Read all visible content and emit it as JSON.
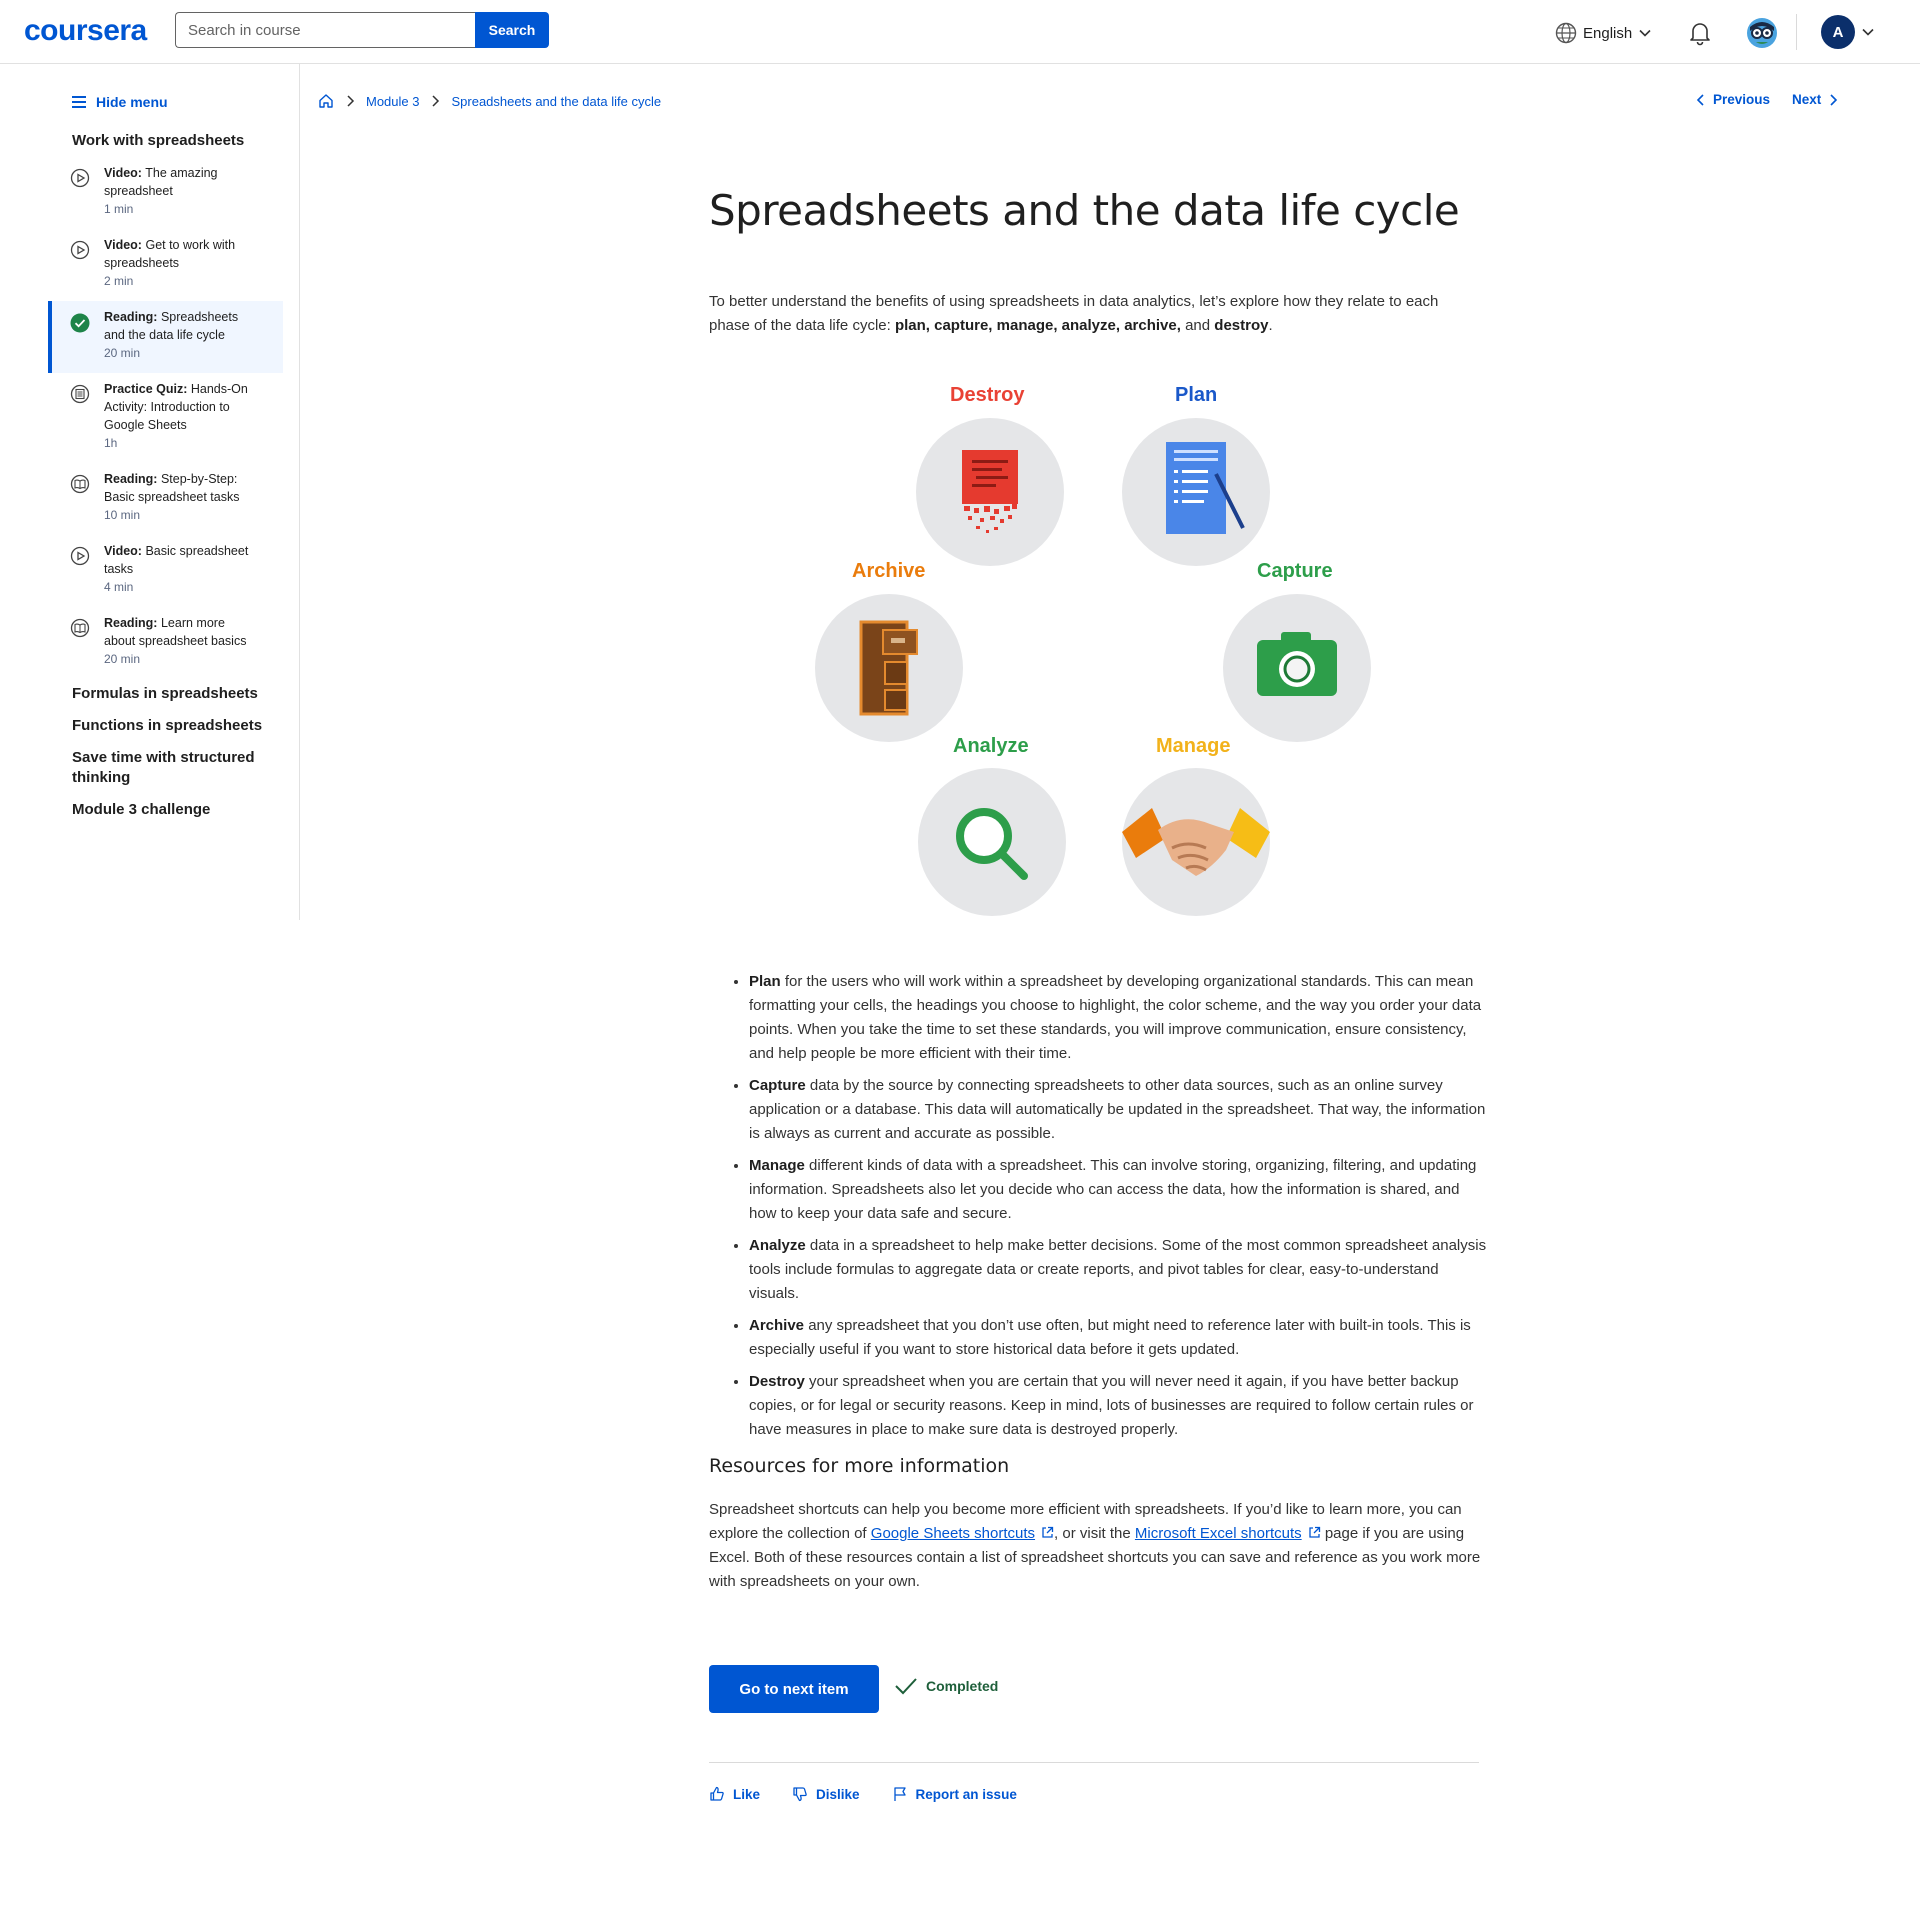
{
  "header": {
    "logo": "coursera",
    "search_placeholder": "Search in course",
    "search_button": "Search",
    "language": "English",
    "avatar_initial": "A",
    "icons": [
      "globe-icon",
      "chevron-down-icon",
      "bell-icon",
      "coach-icon"
    ]
  },
  "sidebar": {
    "hide_menu": "Hide menu",
    "current_section": "Work with spreadsheets",
    "items": [
      {
        "type": "Video:",
        "title": "The amazing spreadsheet",
        "title_l1": "The amazing",
        "title_l2": "spreadsheet",
        "duration": "1 min",
        "icon": "play-icon"
      },
      {
        "type": "Video:",
        "title": "Get to work with spreadsheets",
        "title_l1": "Get to work with",
        "title_l2": "spreadsheets",
        "duration": "2 min",
        "icon": "play-icon"
      },
      {
        "type": "Reading:",
        "title": "Spreadsheets and the data life cycle",
        "title_l1": "Spreadsheets",
        "title_l2": "and the data life cycle",
        "duration": "20 min",
        "icon": "check-circle-icon",
        "active": true
      },
      {
        "type": "Practice Quiz:",
        "title": "Hands-On Activity: Introduction to Google Sheets",
        "title_l1": "Hands-On",
        "title_l2": "Activity: Introduction to",
        "title_l3": "Google Sheets",
        "duration": "1h",
        "icon": "quiz-icon"
      },
      {
        "type": "Reading:",
        "title": "Step-by-Step: Basic spreadsheet tasks",
        "title_l1": "Step-by-Step:",
        "title_l2": "Basic spreadsheet tasks",
        "duration": "10 min",
        "icon": "book-icon"
      },
      {
        "type": "Video:",
        "title": "Basic spreadsheet tasks",
        "title_l1": "Basic spreadsheet",
        "title_l2": "tasks",
        "duration": "4 min",
        "icon": "play-icon"
      },
      {
        "type": "Reading:",
        "title": "Learn more about spreadsheet basics",
        "title_l1": "Learn more",
        "title_l2": "about spreadsheet basics",
        "duration": "20 min",
        "icon": "book-icon"
      }
    ],
    "sections": [
      "Formulas in spreadsheets",
      "Functions in spreadsheets",
      "Save time with structured thinking",
      "Module 3 challenge"
    ],
    "section_wrap": {
      "l1": "Save time with structured",
      "l2": "thinking"
    }
  },
  "breadcrumb": {
    "module": "Module 3",
    "current": "Spreadsheets and the data life cycle"
  },
  "pager": {
    "previous": "Previous",
    "next": "Next"
  },
  "page": {
    "title": "Spreadsheets and the data life cycle",
    "intro_text": "To better understand the benefits of using spreadsheets in data analytics, let’s explore how they relate to each phase of the data life cycle:",
    "intro_phases": "plan, capture, manage, analyze, archive,",
    "intro_and": "and",
    "intro_last": "destroy",
    "intro_end": "."
  },
  "cycle": {
    "stages": [
      {
        "label": "Destroy",
        "color": "#e94235",
        "icon": "shredded-document-icon"
      },
      {
        "label": "Plan",
        "color": "#1a58c9",
        "icon": "document-pen-icon"
      },
      {
        "label": "Capture",
        "color": "#2d9e4a",
        "icon": "camera-icon"
      },
      {
        "label": "Manage",
        "color": "#f2b21b",
        "icon": "handshake-icon"
      },
      {
        "label": "Analyze",
        "color": "#2d9e4a",
        "icon": "magnifier-icon"
      },
      {
        "label": "Archive",
        "color": "#ea7c0c",
        "icon": "filing-cabinet-icon"
      }
    ]
  },
  "stage_list": [
    {
      "term": "Plan",
      "text": "for the users who will work within a spreadsheet by developing organizational standards. This can mean formatting your cells, the headings you choose to highlight, the color scheme, and the way you order your data points. When you take the time to set these standards, you will improve communication, ensure consistency, and help people be more efficient with their time."
    },
    {
      "term": "Capture",
      "text": "data by the source by connecting spreadsheets to other data sources, such as an online survey application or a database. This data will automatically be updated in the spreadsheet. That way, the information is always as current and accurate as possible."
    },
    {
      "term": "Manage",
      "text": "different kinds of data with a spreadsheet. This can involve storing, organizing, filtering, and updating information. Spreadsheets also let you decide who can access the data, how the information is shared, and how to keep your data safe and secure."
    },
    {
      "term": "Analyze",
      "text": "data in a spreadsheet to help make better decisions. Some of the most common spreadsheet analysis tools include formulas to aggregate data or create reports, and pivot tables for clear, easy-to-understand visuals."
    },
    {
      "term": "Archive",
      "text": "any spreadsheet that you don’t use often, but might need to reference later with built-in tools. This is especially useful if you want to store historical data before it gets updated."
    },
    {
      "term": "Destroy",
      "text": "your spreadsheet when you are certain that you will never need it again, if you have better backup copies, or for legal or security reasons. Keep in mind, lots of businesses are required to follow certain rules or have measures in place to make sure data is destroyed properly."
    }
  ],
  "resources": {
    "title": "Resources for more information",
    "text_1": "Spreadsheet shortcuts can help you become more efficient with spreadsheets. If you’d like to learn more, you can explore the collection of",
    "link_1": "Google Sheets shortcuts",
    "text_2": ", or visit the",
    "link_2": "Microsoft Excel shortcuts",
    "text_3": "page if you are using Excel. Both of these resources contain a list of spreadsheet shortcuts you can save and reference as you work more with spreadsheets on your own."
  },
  "actions": {
    "next_item": "Go to next item",
    "completed": "Completed",
    "like": "Like",
    "dislike": "Dislike",
    "report": "Report an issue"
  },
  "colors": {
    "accent": "#0056d2",
    "active_bg": "#f0f6ff",
    "completed": "#1e5f3a"
  }
}
